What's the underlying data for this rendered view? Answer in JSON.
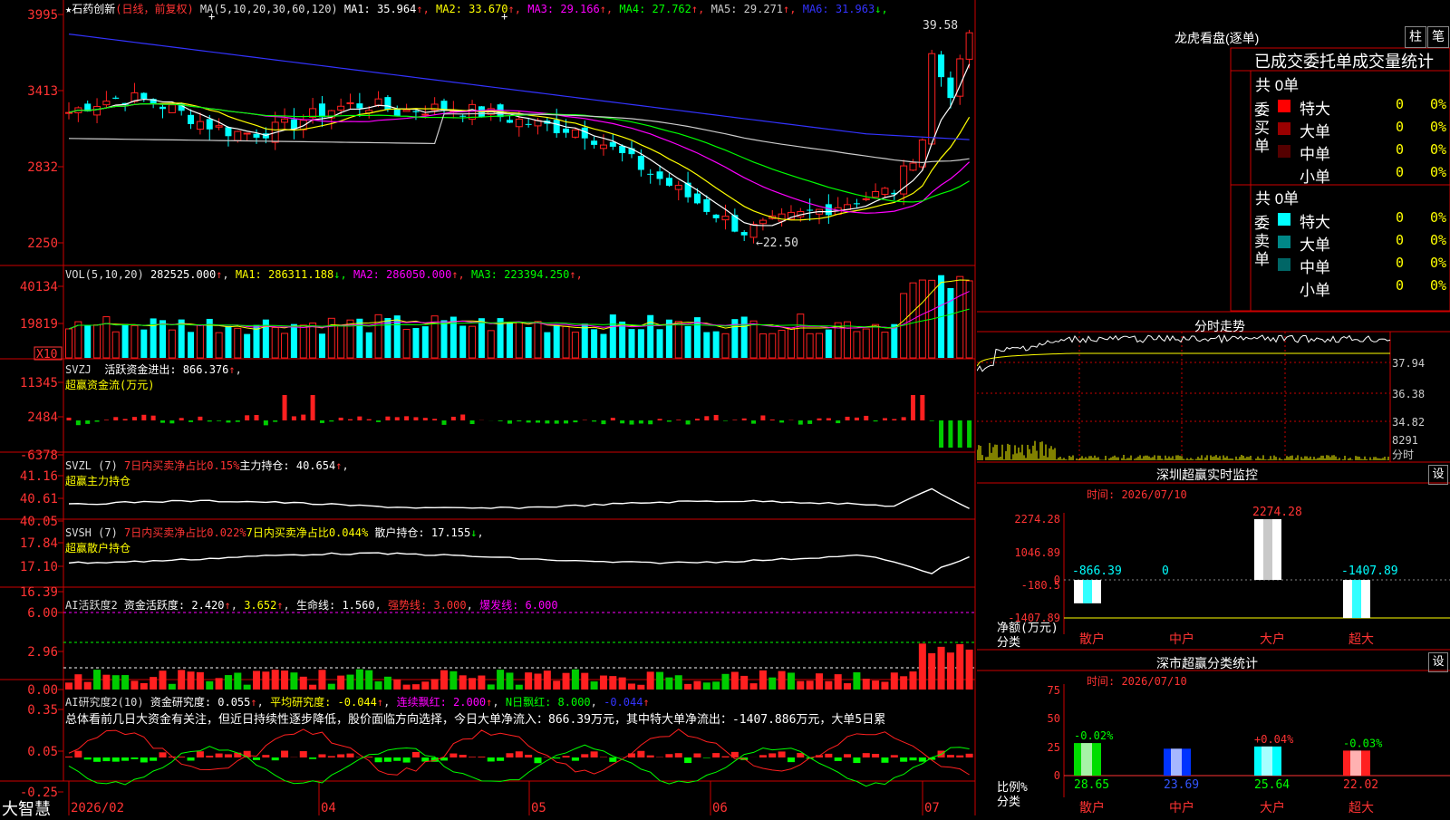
{
  "app": {
    "name": "大智慧"
  },
  "stock": {
    "name": "★石药创新",
    "period": "(日线，前复权)",
    "ma_label": "MA(5,10,20,30,60,120)",
    "ma": [
      {
        "label": "MA1: 35.964",
        "arrow": "↑",
        "color": "#ffffff"
      },
      {
        "label": "MA2: 33.670",
        "arrow": "↑",
        "color": "#ffff00"
      },
      {
        "label": "MA3: 29.166",
        "arrow": "↑",
        "color": "#ff00ff"
      },
      {
        "label": "MA4: 27.762",
        "arrow": "↑",
        "color": "#00ff00"
      },
      {
        "label": "MA5: 29.271",
        "arrow": "↑",
        "color": "#cccccc"
      },
      {
        "label": "MA6: 31.963",
        "arrow": "↓",
        "color": "#3333ff"
      }
    ],
    "price_axis": [
      "3995",
      "3413",
      "2832",
      "2250"
    ],
    "high_label": "39.58",
    "low_label": "←22.50"
  },
  "vol": {
    "title": "VOL(5,10,20)",
    "value": "282525.000",
    "ma": [
      {
        "label": "MA1: 286311.188",
        "arrow": "↓",
        "color": "#ffff00"
      },
      {
        "label": "MA2: 286050.000",
        "arrow": "↑",
        "color": "#ff00ff"
      },
      {
        "label": "MA3: 223394.250",
        "arrow": "↑",
        "color": "#00ff00"
      }
    ],
    "axis": [
      "40134",
      "19819"
    ],
    "unit": "X10"
  },
  "svzj": {
    "title": "SVZJ",
    "line1": "活跃资金进出: 866.376",
    "arrow": "↑",
    "comma": ",",
    "sub": "超赢资金流(万元)",
    "axis": [
      "11345",
      "2484",
      "-6378"
    ]
  },
  "svzl": {
    "title": "SVZL (7)",
    "pct": "7日内买卖净占比0.15%",
    "line": "主力持仓: 40.654",
    "arrow": "↑",
    "comma": ",",
    "sub": "超赢主力持仓",
    "axis": [
      "41.16",
      "40.61",
      "40.05"
    ]
  },
  "svsh": {
    "title": "SVSH (7)",
    "pct1": "7日内买卖净占比0.022%",
    "pct2": "7日内买卖净占比0.044%",
    "line": "散户持仓: 17.155",
    "arrow": "↓",
    "comma": ",",
    "sub": "超赢散户持仓",
    "axis": [
      "17.84",
      "17.10",
      "16.39"
    ]
  },
  "ai1": {
    "title": "AI活跃度2",
    "v1": "资金活跃度: 2.420",
    "v2": "3.652",
    "v3": "生命线: 1.560",
    "v4": "强势线: 3.000",
    "v5": "爆发线: 6.000",
    "axis": [
      "6.00",
      "2.96",
      "0.00"
    ]
  },
  "ai2": {
    "title": "AI研究度2(10)",
    "v1": "资金研究度: 0.055",
    "v2": "平均研究度: -0.044",
    "v3": "连续飘红: 2.000",
    "v4": "N日飘红: 8.000",
    "v5": "-0.044",
    "summary": "总体看前几日大资金有关注，但近日持续性逐步降低，股价面临方向选择，今日大单净流入：866.39万元，其中特大单净流出：-1407.886万元，大单5日累",
    "axis": [
      "0.35",
      "0.05",
      "-0.25"
    ]
  },
  "dates": [
    "2026/02",
    "04",
    "05",
    "06",
    "07"
  ],
  "longhu": {
    "title": "龙虎看盘(逐单)",
    "btn1": "柱",
    "btn2": "笔",
    "header": "已成交委托单成交量统计",
    "buy": {
      "side": "委买单",
      "total": "共 0单",
      "rows": [
        {
          "name": "特大",
          "v": "0",
          "p": "0%",
          "color": "#ff0000"
        },
        {
          "name": "大单",
          "v": "0",
          "p": "0%",
          "color": "#990000"
        },
        {
          "name": "中单",
          "v": "0",
          "p": "0%",
          "color": "#550000"
        },
        {
          "name": "小单",
          "v": "0",
          "p": "0%",
          "color": ""
        }
      ]
    },
    "sell": {
      "side": "委卖单",
      "total": "共 0单",
      "rows": [
        {
          "name": "特大",
          "v": "0",
          "p": "0%",
          "color": "#00ffff"
        },
        {
          "name": "大单",
          "v": "0",
          "p": "0%",
          "color": "#008888"
        },
        {
          "name": "中单",
          "v": "0",
          "p": "0%",
          "color": "#006666"
        },
        {
          "name": "小单",
          "v": "0",
          "p": "0%",
          "color": ""
        }
      ]
    }
  },
  "intraday": {
    "title": "分时走势",
    "axis": [
      "37.94",
      "36.38",
      "34.82"
    ],
    "vol_label": "8291",
    "vol_unit": "分时"
  },
  "monitor": {
    "title": "深圳超赢实时监控",
    "btn": "设",
    "time": "时间: 2026/07/10",
    "axis": [
      "2274.28",
      "1046.89",
      "0",
      "-180.5",
      "-1407.89"
    ],
    "ylabel": "净额(万元)",
    "xlabel": "分类",
    "chart_data": {
      "type": "bar",
      "categories": [
        "散户",
        "中户",
        "大户",
        "超大"
      ],
      "values": [
        -866.39,
        0,
        2274.28,
        -1407.89
      ],
      "labels": [
        "-866.39",
        "0",
        "2274.28",
        "-1407.89"
      ],
      "ylim": [
        -1407.89,
        2274.28
      ]
    }
  },
  "classify": {
    "title": "深市超赢分类统计",
    "btn": "设",
    "time": "时间: 2026/07/10",
    "axis": [
      "75",
      "50",
      "25",
      "0"
    ],
    "ylabel": "比例%",
    "xlabel": "分类",
    "chart_data": {
      "type": "bar",
      "categories": [
        "散户",
        "中户",
        "大户",
        "超大"
      ],
      "values": [
        28.65,
        23.69,
        25.64,
        22.02
      ],
      "labels": [
        "28.65",
        "23.69",
        "25.64",
        "22.02"
      ],
      "changes": [
        "-0.02%",
        "",
        "+0.04%",
        "-0.03%"
      ],
      "ylim": [
        0,
        75
      ]
    }
  },
  "chart_data": {
    "type": "candlestick",
    "title": "★石药创新",
    "price_ylim": [
      22.5,
      39.58
    ],
    "series": [
      {
        "name": "MA1"
      },
      {
        "name": "MA2"
      },
      {
        "name": "MA3"
      },
      {
        "name": "MA4"
      },
      {
        "name": "MA5"
      },
      {
        "name": "MA6"
      }
    ]
  }
}
